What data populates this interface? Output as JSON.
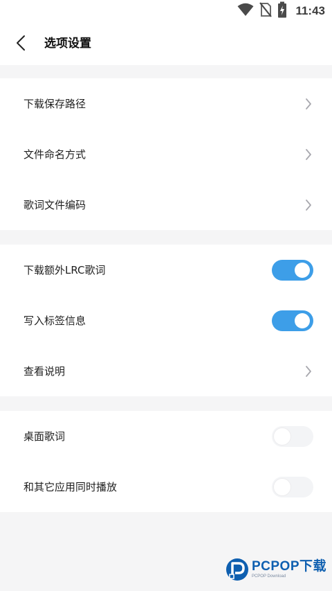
{
  "status_bar": {
    "time": "11:43",
    "icons": [
      "wifi-icon",
      "no-sim-icon",
      "battery-charging-icon"
    ]
  },
  "header": {
    "title": "选项设置",
    "back_icon": "chevron-left-icon"
  },
  "section1": {
    "items": [
      {
        "label": "下载保存路径",
        "control": "chevron"
      },
      {
        "label": "文件命名方式",
        "control": "chevron"
      },
      {
        "label": "歌词文件编码",
        "control": "chevron"
      }
    ]
  },
  "section2": {
    "items": [
      {
        "label": "下载额外LRC歌词",
        "control": "toggle",
        "enabled": true
      },
      {
        "label": "写入标签信息",
        "control": "toggle",
        "enabled": true
      },
      {
        "label": "查看说明",
        "control": "chevron"
      }
    ]
  },
  "section3": {
    "items": [
      {
        "label": "桌面歌词",
        "control": "toggle",
        "enabled": false
      },
      {
        "label": "和其它应用同时播放",
        "control": "toggle",
        "enabled": false
      }
    ]
  },
  "watermark": {
    "brand": "PCPOP下载",
    "sub": "PCPOP Download"
  },
  "colors": {
    "accent": "#3d9ee8",
    "background": "#f5f5f6",
    "surface": "#ffffff"
  }
}
